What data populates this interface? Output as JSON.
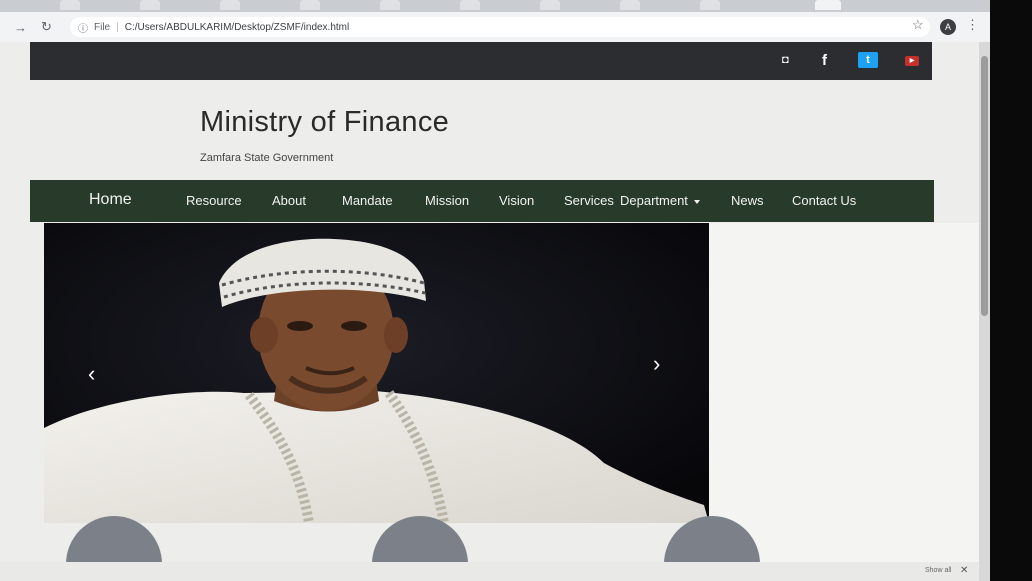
{
  "browser": {
    "url_scheme": "File",
    "url_path": "C:/Users/ABDULKARIM/Desktop/ZSMF/index.html",
    "profile_initial": "A"
  },
  "site": {
    "title": "Ministry of Finance",
    "tagline": "Zamfara State Government"
  },
  "nav": {
    "items": [
      "Home",
      "Resource",
      "About",
      "Mandate",
      "Mission",
      "Vision",
      "Services",
      "Department",
      "News",
      "Contact Us"
    ]
  },
  "downloads": {
    "show_all": "Show all"
  },
  "colors": {
    "nav_bg": "#283a29",
    "topbar_bg": "#2b2d30",
    "page_bg": "#ededeb"
  }
}
